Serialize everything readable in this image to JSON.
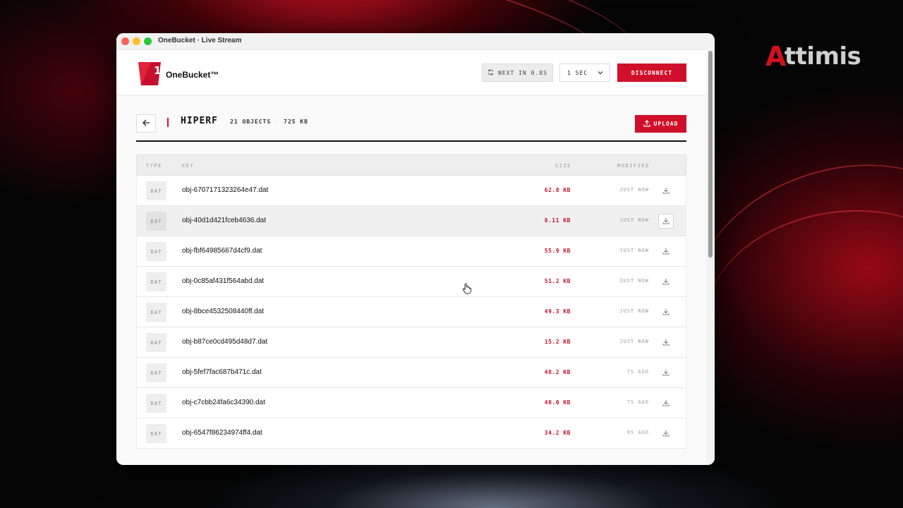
{
  "window": {
    "title": "OneBucket · Live Stream"
  },
  "desktop": {
    "brand_rest": "ttimis",
    "brand_initial": "A"
  },
  "header": {
    "logo_digit": "1",
    "logo_text": "OneBucket™",
    "next_label": "NEXT IN 0.8S",
    "interval_value": "1 SEC",
    "disconnect_label": "DISCONNECT"
  },
  "bucket": {
    "name": "HIPERF",
    "objects": "21 OBJECTS",
    "size": "725 KB",
    "upload_label": "UPLOAD"
  },
  "table": {
    "headers": {
      "type": "TYPE",
      "key": "KEY",
      "size": "SIZE",
      "modified": "MODIFIED"
    },
    "rows": [
      {
        "type": "DAT",
        "key": "obj-6707171323264e47.dat",
        "size": "62.8 KB",
        "modified": "JUST NOW"
      },
      {
        "type": "DAT",
        "key": "obj-40d1d421fceb4636.dat",
        "size": "8.11 KB",
        "modified": "JUST NOW"
      },
      {
        "type": "DAT",
        "key": "obj-fbf64985667d4cf9.dat",
        "size": "55.9 KB",
        "modified": "JUST NOW"
      },
      {
        "type": "DAT",
        "key": "obj-0c85af431f564abd.dat",
        "size": "51.2 KB",
        "modified": "JUST NOW"
      },
      {
        "type": "DAT",
        "key": "obj-8bce4532508440ff.dat",
        "size": "49.3 KB",
        "modified": "JUST NOW"
      },
      {
        "type": "DAT",
        "key": "obj-b87ce0cd495d48d7.dat",
        "size": "15.2 KB",
        "modified": "JUST NOW"
      },
      {
        "type": "DAT",
        "key": "obj-5fef7fac687b471c.dat",
        "size": "48.2 KB",
        "modified": "7S AGO"
      },
      {
        "type": "DAT",
        "key": "obj-c7cbb24fa6c34390.dat",
        "size": "40.0 KB",
        "modified": "7S AGO"
      },
      {
        "type": "DAT",
        "key": "obj-6547f86234974ff4.dat",
        "size": "34.2 KB",
        "modified": "9S AGO"
      }
    ]
  },
  "colors": {
    "accent": "#d0102a",
    "size_text": "#c8102e"
  }
}
